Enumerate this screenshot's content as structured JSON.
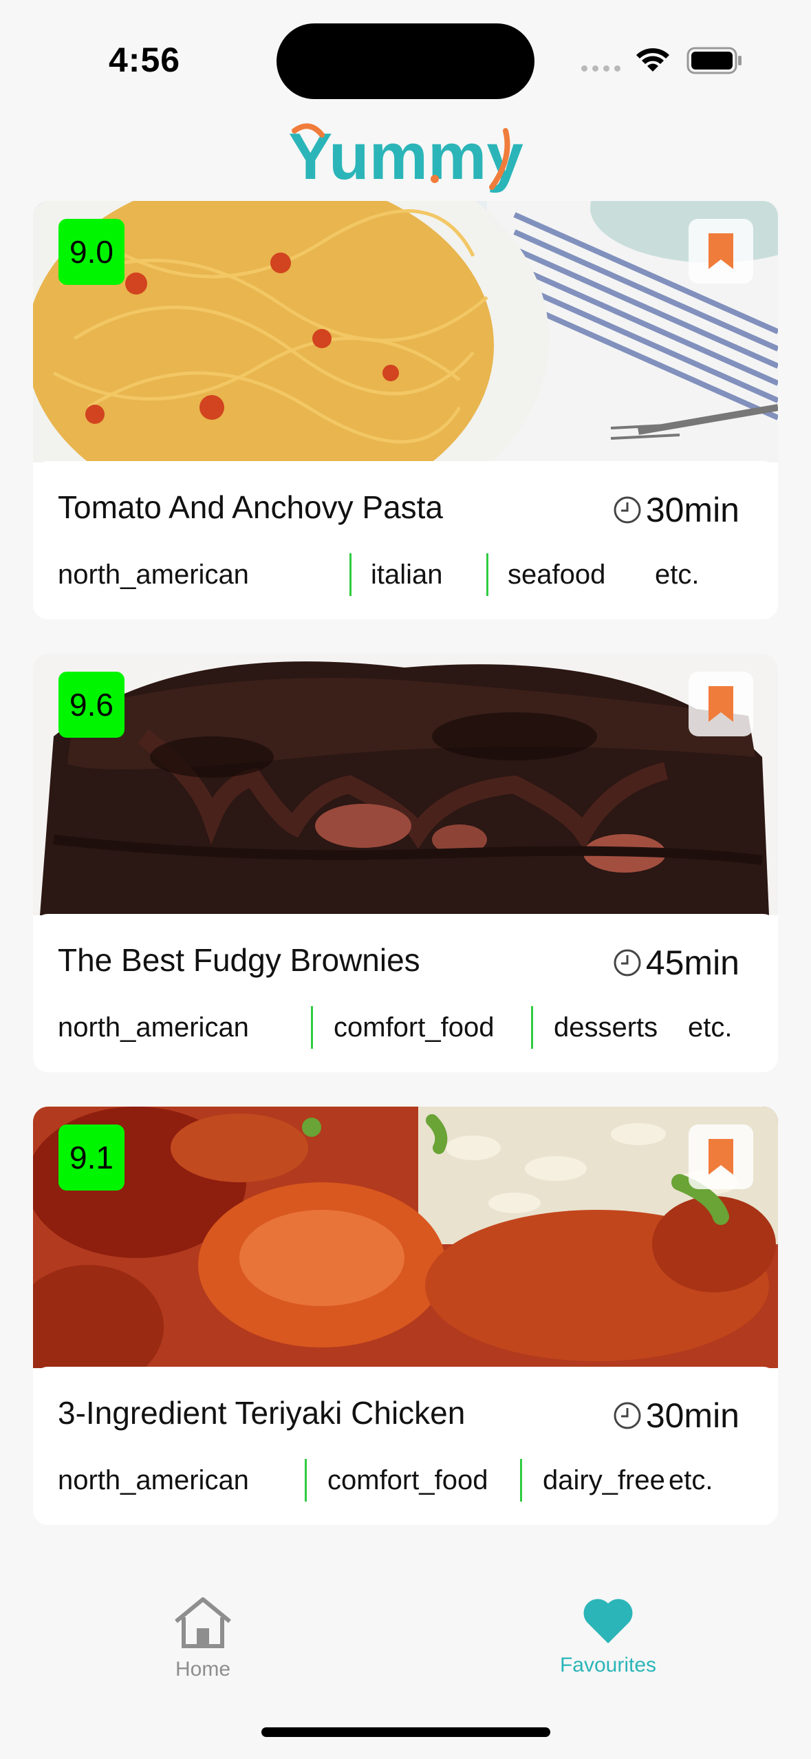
{
  "status_bar": {
    "time": "4:56"
  },
  "app": {
    "logo_text": "Yummy",
    "brand_color": "#2bb5b8",
    "accent_color": "#f07c3c"
  },
  "recipes": [
    {
      "rating": "9.0",
      "title": "Tomato And Anchovy Pasta",
      "time": "30min",
      "tags": [
        "north_american",
        "italian",
        "seafood"
      ],
      "more": "etc.",
      "bookmark_icon": "bookmark-icon"
    },
    {
      "rating": "9.6",
      "title": "The Best Fudgy Brownies",
      "time": "45min",
      "tags": [
        "north_american",
        "comfort_food",
        "desserts"
      ],
      "more": "etc.",
      "bookmark_icon": "bookmark-icon"
    },
    {
      "rating": "9.1",
      "title": "3-Ingredient Teriyaki Chicken",
      "time": "30min",
      "tags": [
        "north_american",
        "comfort_food",
        "dairy_free"
      ],
      "more": "etc.",
      "bookmark_icon": "bookmark-icon"
    }
  ],
  "tab_bar": {
    "tabs": [
      {
        "label": "Home",
        "icon": "home-icon",
        "active": false
      },
      {
        "label": "Favourites",
        "icon": "heart-icon",
        "active": true
      }
    ],
    "active_color": "#2bb5b8",
    "inactive_color": "#8e8e8e"
  }
}
